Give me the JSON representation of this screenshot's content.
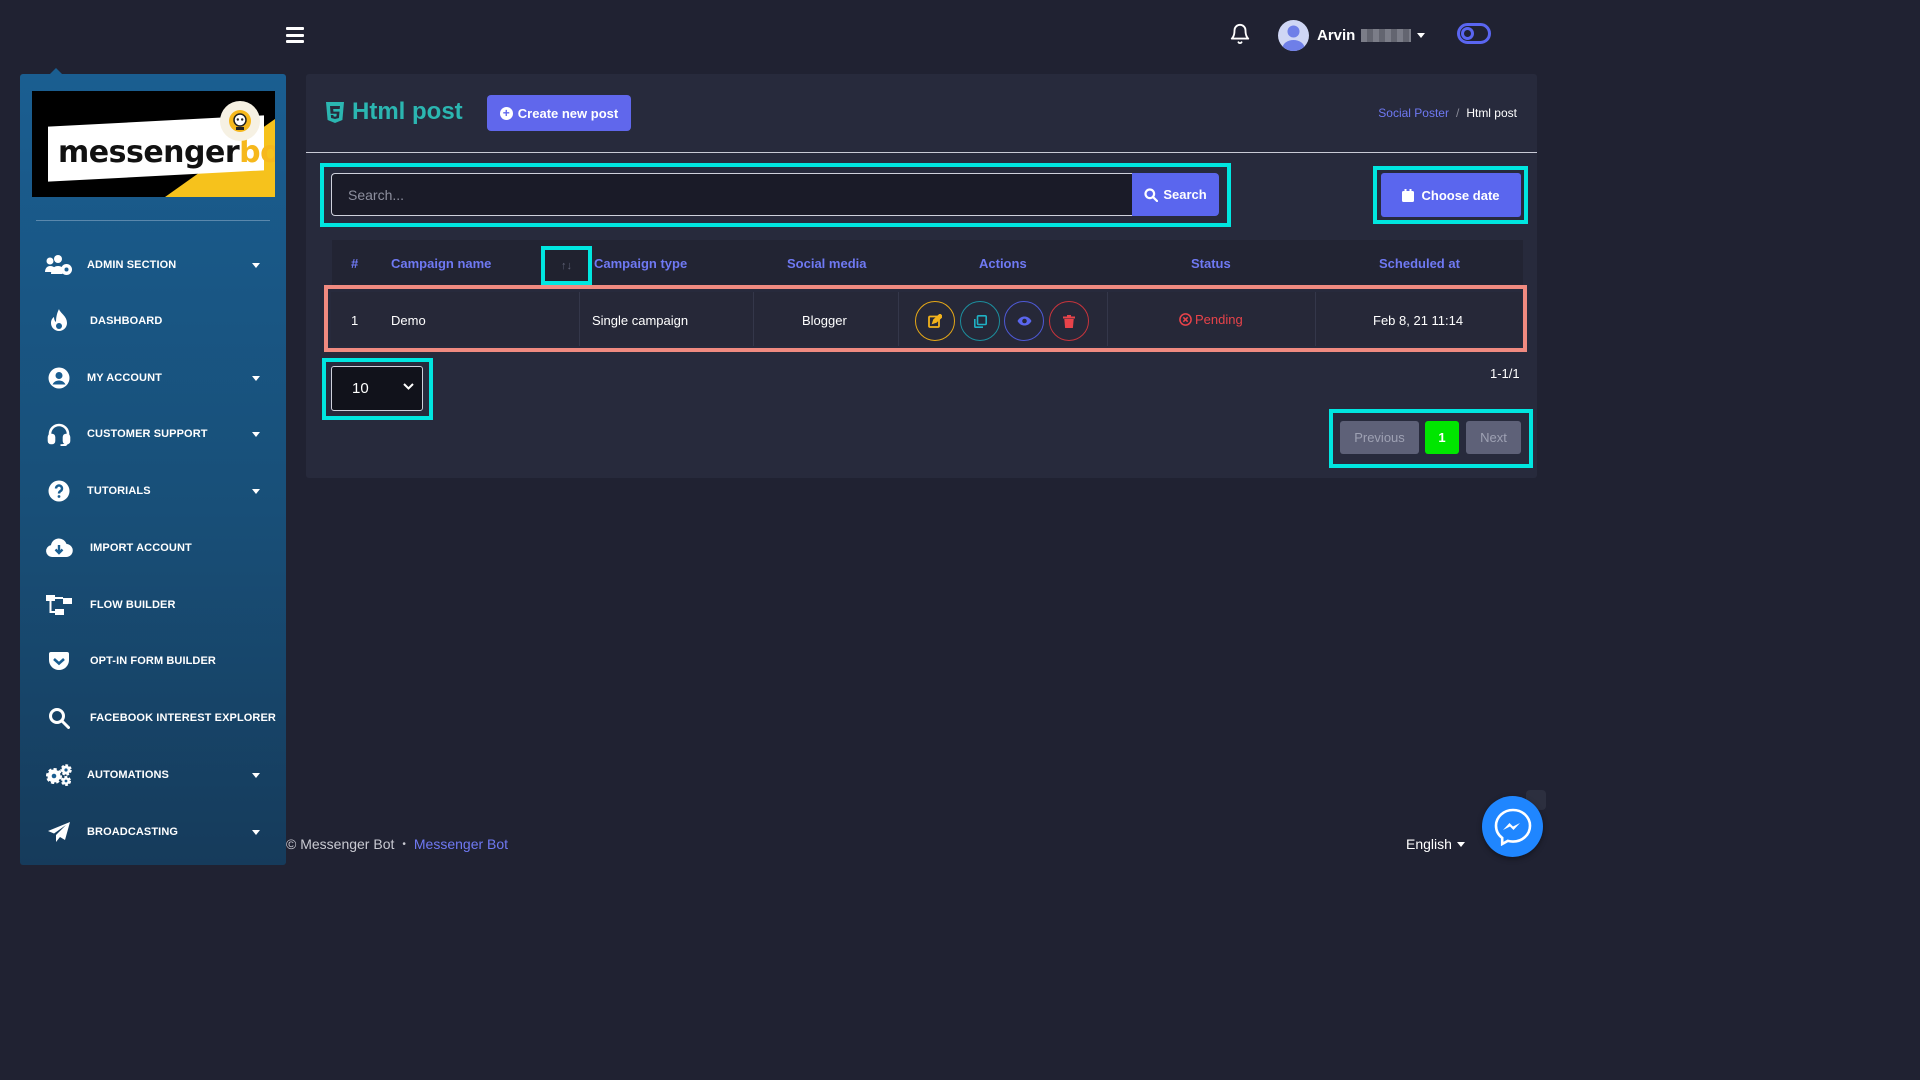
{
  "header": {
    "user_name": "Arvin"
  },
  "sidebar": {
    "logo_text_1": "messenger",
    "logo_text_2": "bot",
    "items": [
      {
        "label": "ADMIN SECTION",
        "icon": "users-cog-icon",
        "has_caret": true
      },
      {
        "label": "DASHBOARD",
        "icon": "fire-icon",
        "has_caret": false
      },
      {
        "label": "MY ACCOUNT",
        "icon": "user-circle-icon",
        "has_caret": true
      },
      {
        "label": "CUSTOMER SUPPORT",
        "icon": "headset-icon",
        "has_caret": true
      },
      {
        "label": "TUTORIALS",
        "icon": "question-circle-icon",
        "has_caret": true
      },
      {
        "label": "IMPORT ACCOUNT",
        "icon": "cloud-download-icon",
        "has_caret": false
      },
      {
        "label": "FLOW BUILDER",
        "icon": "sitemap-icon",
        "has_caret": false
      },
      {
        "label": "OPT-IN FORM BUILDER",
        "icon": "pocket-icon",
        "has_caret": false
      },
      {
        "label": "FACEBOOK INTEREST EXPLORER",
        "icon": "search-icon",
        "has_caret": false
      },
      {
        "label": "AUTOMATIONS",
        "icon": "cogs-icon",
        "has_caret": true
      },
      {
        "label": "BROADCASTING",
        "icon": "paper-plane-icon",
        "has_caret": true
      }
    ]
  },
  "page": {
    "title": "Html post",
    "create_button": "Create new post",
    "breadcrumb": {
      "parent": "Social Poster",
      "separator": "/",
      "current": "Html post"
    }
  },
  "search": {
    "placeholder": "Search...",
    "button": "Search",
    "date_button": "Choose date"
  },
  "table": {
    "columns": [
      "#",
      "Campaign name",
      "Campaign type",
      "Social media",
      "Actions",
      "Status",
      "Scheduled at"
    ],
    "sort_glyph": "↑↓",
    "rows": [
      {
        "num": "1",
        "name": "Demo",
        "type": "Single campaign",
        "social": "Blogger",
        "status": "Pending",
        "scheduled": "Feb 8, 21 11:14"
      }
    ]
  },
  "pagination": {
    "page_size": "10",
    "range": "1-1/1",
    "previous": "Previous",
    "current": "1",
    "next": "Next"
  },
  "footer": {
    "copyright": "© Messenger Bot",
    "bullet": "•",
    "link": "Messenger Bot",
    "language": "English"
  },
  "colors": {
    "accent": "#5a66ee",
    "highlight": "#00e6e0",
    "title": "#2bb6b1",
    "status_pending": "#e8434a",
    "current_page": "#00e600"
  }
}
